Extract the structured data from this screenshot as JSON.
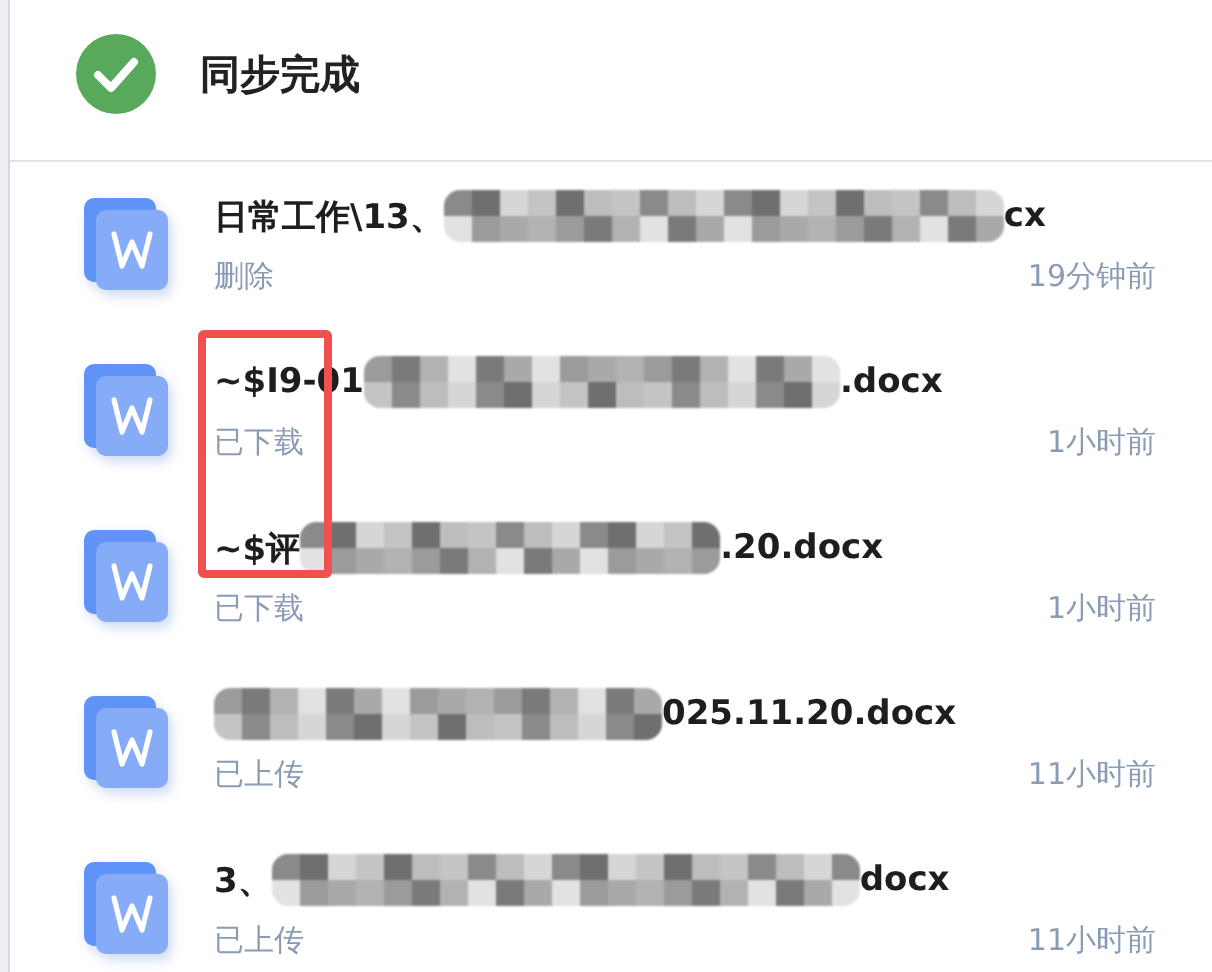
{
  "header": {
    "title": "同步完成"
  },
  "files": [
    {
      "name_start": "日常工作\\13、",
      "name_end": "cx",
      "status": "删除",
      "time": "19分钟前"
    },
    {
      "name_start": "~$I9-01",
      "name_end": ".docx",
      "status": "已下载",
      "time": "1小时前"
    },
    {
      "name_start": "~$评",
      "name_end": ".20.docx",
      "status": "已下载",
      "time": "1小时前"
    },
    {
      "name_end": "025.11.20.docx",
      "status": "已上传",
      "time": "11小时前"
    },
    {
      "name_start": "3、",
      "name_end": "docx",
      "status": "已上传",
      "time": "11小时前"
    }
  ]
}
